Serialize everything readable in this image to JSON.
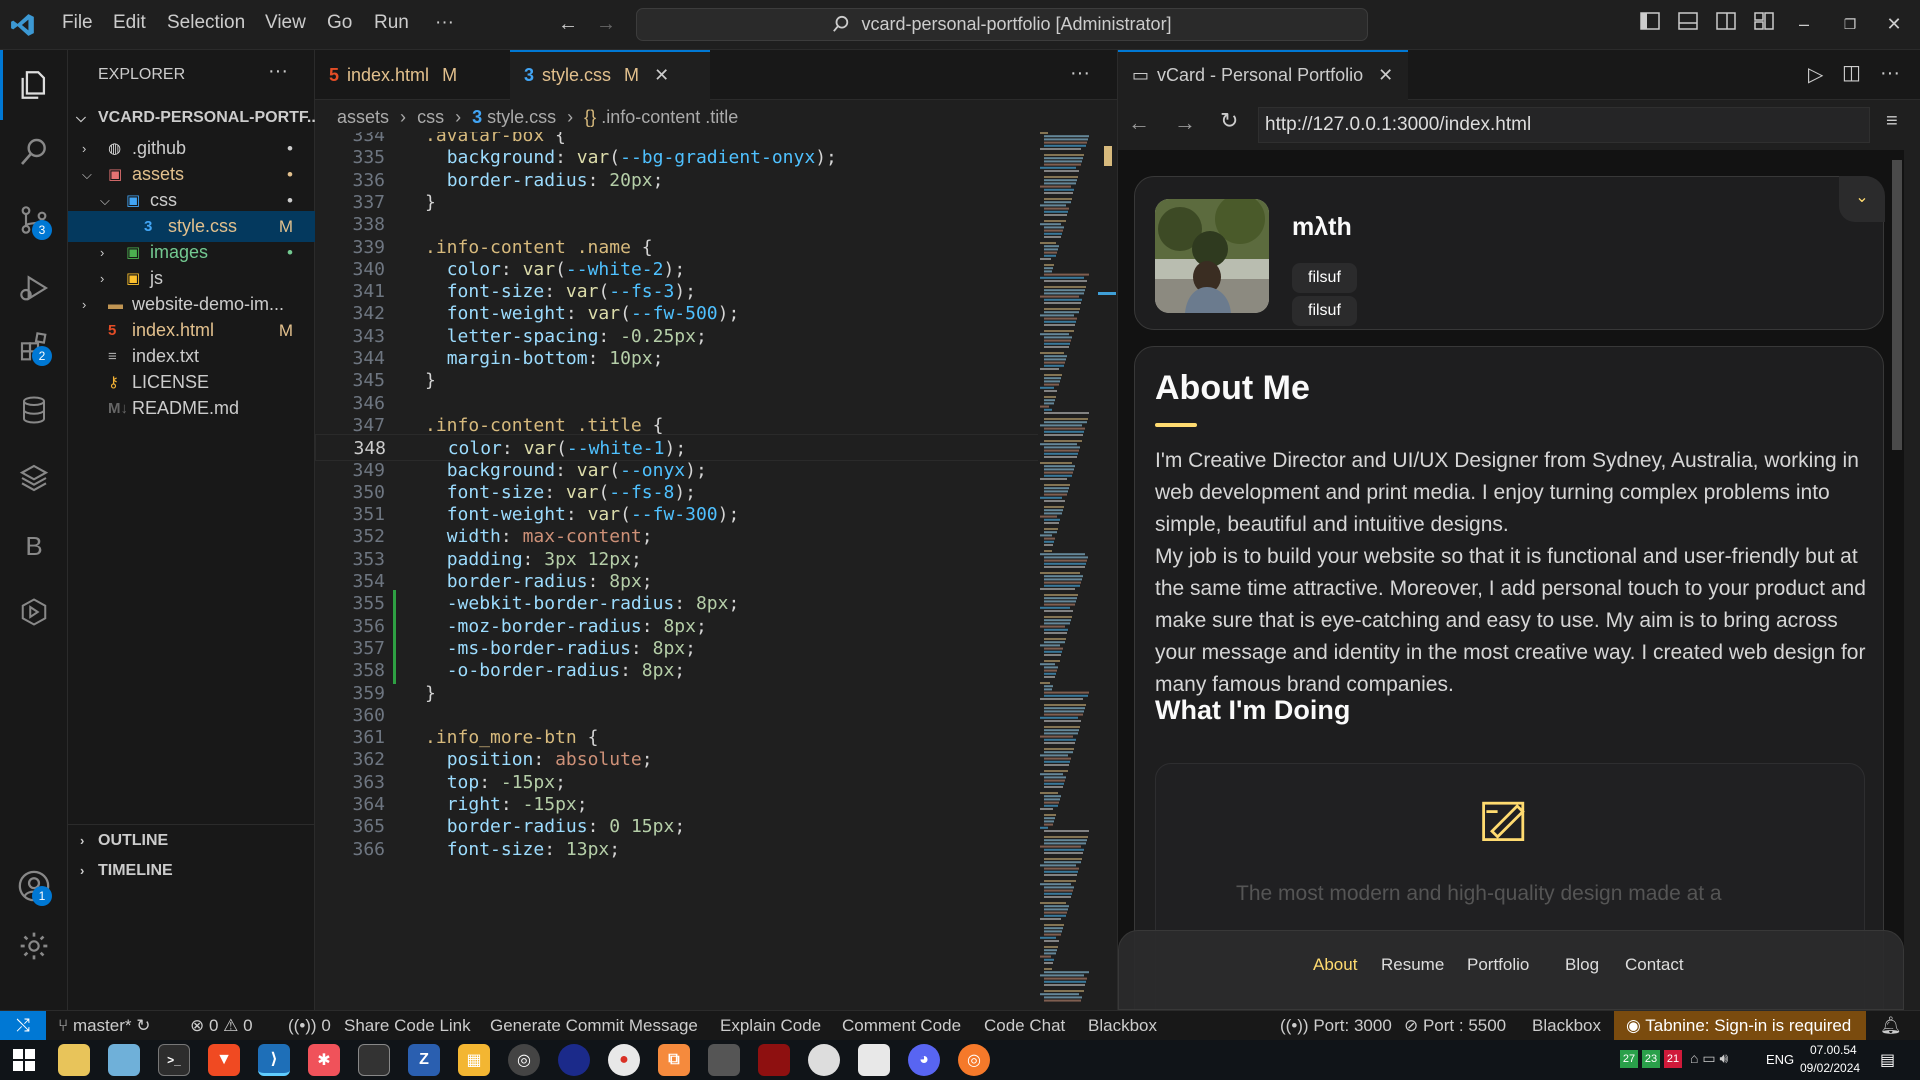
{
  "titlebar": {
    "menu": [
      "File",
      "Edit",
      "Selection",
      "View",
      "Go",
      "Run",
      "···"
    ],
    "command_center": "vcard-personal-portfolio [Administrator]",
    "accent": "#0078d4"
  },
  "activity": {
    "badges": {
      "source_control": "3",
      "extensions": "2",
      "accounts": "1"
    },
    "letter_b": "B"
  },
  "explorer": {
    "title": "EXPLORER",
    "root": "VCARD-PERSONAL-PORTF...",
    "items": [
      {
        "label": ".github",
        "icon": "github-folder-icon",
        "status": "•"
      },
      {
        "label": "assets",
        "icon": "assets-folder-icon",
        "status": "•"
      },
      {
        "label": "css",
        "icon": "css-folder-icon",
        "status": "•"
      },
      {
        "label": "style.css",
        "icon": "css-file-icon",
        "status": "M"
      },
      {
        "label": "images",
        "icon": "images-folder-icon",
        "status": "•"
      },
      {
        "label": "js",
        "icon": "js-folder-icon",
        "status": ""
      },
      {
        "label": "website-demo-im...",
        "icon": "folder-icon",
        "status": ""
      },
      {
        "label": "index.html",
        "icon": "html-file-icon",
        "status": "M"
      },
      {
        "label": "index.txt",
        "icon": "text-file-icon",
        "status": ""
      },
      {
        "label": "LICENSE",
        "icon": "license-file-icon",
        "status": ""
      },
      {
        "label": "README.md",
        "icon": "markdown-file-icon",
        "status": ""
      }
    ],
    "outline": "OUTLINE",
    "timeline": "TIMELINE"
  },
  "editor": {
    "tabs": [
      {
        "label": "index.html",
        "status": "M"
      },
      {
        "label": "style.css",
        "status": "M"
      }
    ],
    "breadcrumbs": [
      "assets",
      "css",
      "style.css",
      ".info-content .title"
    ],
    "current_line": 348,
    "lines": [
      {
        "n": "334",
        "t": ".avatar-box {"
      },
      {
        "n": "335",
        "t": "  background: var(--bg-gradient-onyx);"
      },
      {
        "n": "336",
        "t": "  border-radius: 20px;"
      },
      {
        "n": "337",
        "t": "}"
      },
      {
        "n": "338",
        "t": ""
      },
      {
        "n": "339",
        "t": ".info-content .name {"
      },
      {
        "n": "340",
        "t": "  color: var(--white-2);"
      },
      {
        "n": "341",
        "t": "  font-size: var(--fs-3);"
      },
      {
        "n": "342",
        "t": "  font-weight: var(--fw-500);"
      },
      {
        "n": "343",
        "t": "  letter-spacing: -0.25px;"
      },
      {
        "n": "344",
        "t": "  margin-bottom: 10px;"
      },
      {
        "n": "345",
        "t": "}"
      },
      {
        "n": "346",
        "t": ""
      },
      {
        "n": "347",
        "t": ".info-content .title {"
      },
      {
        "n": "348",
        "t": "  color: var(--white-1);"
      },
      {
        "n": "349",
        "t": "  background: var(--onyx);"
      },
      {
        "n": "350",
        "t": "  font-size: var(--fs-8);"
      },
      {
        "n": "351",
        "t": "  font-weight: var(--fw-300);"
      },
      {
        "n": "352",
        "t": "  width: max-content;"
      },
      {
        "n": "353",
        "t": "  padding: 3px 12px;"
      },
      {
        "n": "354",
        "t": "  border-radius: 8px;"
      },
      {
        "n": "355",
        "t": "  -webkit-border-radius: 8px;"
      },
      {
        "n": "356",
        "t": "  -moz-border-radius: 8px;"
      },
      {
        "n": "357",
        "t": "  -ms-border-radius: 8px;"
      },
      {
        "n": "358",
        "t": "  -o-border-radius: 8px;"
      },
      {
        "n": "359",
        "t": "}"
      },
      {
        "n": "360",
        "t": ""
      },
      {
        "n": "361",
        "t": ".info_more-btn {"
      },
      {
        "n": "362",
        "t": "  position: absolute;"
      },
      {
        "n": "363",
        "t": "  top: -15px;"
      },
      {
        "n": "364",
        "t": "  right: -15px;"
      },
      {
        "n": "365",
        "t": "  border-radius: 0 15px;"
      },
      {
        "n": "366",
        "t": "  font-size: 13px;"
      }
    ]
  },
  "browser": {
    "tab_title": "vCard - Personal Portfolio",
    "url": "http://127.0.0.1:3000/index.html",
    "profile": {
      "name": "mλth",
      "titles": [
        "filsuf",
        "filsuf"
      ]
    },
    "about": {
      "heading": "About Me",
      "p1": "I'm Creative Director and UI/UX Designer from Sydney, Australia, working in web development and print media. I enjoy turning complex problems into simple, beautiful and intuitive designs.",
      "p2": "My job is to build your website so that it is functional and user-friendly but at the same time attractive. Moreover, I add personal touch to your product and make sure that is eye-catching and easy to use. My aim is to bring across your message and identity in the most creative way. I created web design for many famous brand companies.",
      "doing_heading": "What I'm Doing",
      "service_peek": "The most modern and high-quality design made at a"
    },
    "nav": [
      "About",
      "Resume",
      "Portfolio",
      "Blog",
      "Contact"
    ],
    "accent": "#ffdb70"
  },
  "statusbar": {
    "branch": "master*",
    "errors": "0",
    "warnings": "0",
    "ports": "0",
    "items": [
      "Share Code Link",
      "Generate Commit Message",
      "Explain Code",
      "Comment Code",
      "Code Chat",
      "Blackbox"
    ],
    "port_3000": "Port: 3000",
    "port_5500": "Port : 5500",
    "blackbox": "Blackbox",
    "tabnine": "Tabnine: Sign-in is required",
    "tabnine_color": "#7a4b0e"
  },
  "taskbar": {
    "tray": {
      "lang": "ENG",
      "time": "07.00.54",
      "date": "09/02/2024",
      "tray_numbers": [
        "27",
        "23",
        "21"
      ]
    }
  }
}
